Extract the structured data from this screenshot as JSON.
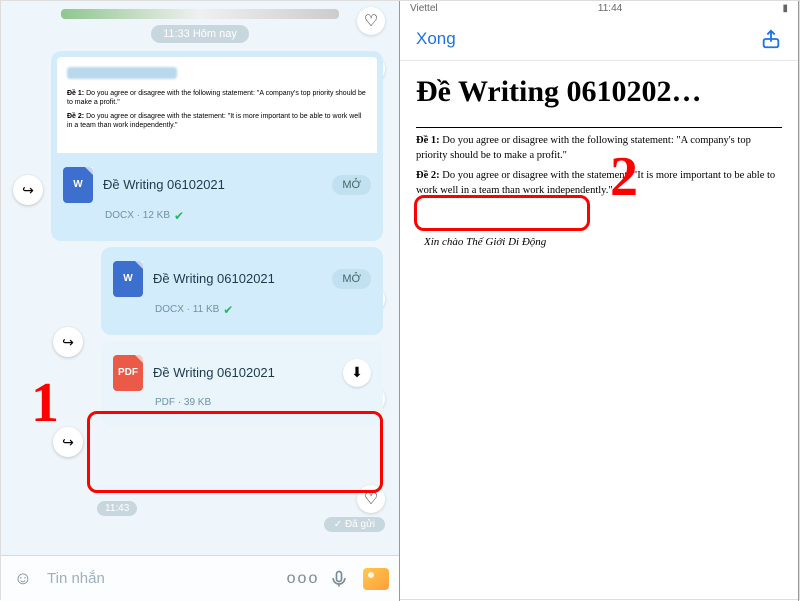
{
  "left": {
    "timestamp_pill": "11:33 Hôm nay",
    "preview": {
      "line1_label": "Đề 1:",
      "line1_text": "Do you agree or disagree with the following statement: \"A company's top priority should be to make a profit.\"",
      "line2_label": "Đề 2:",
      "line2_text": "Do you agree or disagree with the statement: \"It is more important to be able to work well in a team than work independently.\""
    },
    "files": [
      {
        "name": "Đề Writing 06102021",
        "meta": "DOCX · 12 KB",
        "open": "MỞ"
      },
      {
        "name": "Đề Writing 06102021",
        "meta": "DOCX · 11 KB",
        "open": "MỞ"
      },
      {
        "name": "Đề Writing 06102021",
        "meta": "PDF · 39 KB"
      }
    ],
    "time_small": "11:43",
    "sent_label": "✓ Đã gửi",
    "compose_placeholder": "Tin nhắn",
    "annotation_1": "1"
  },
  "right": {
    "carrier": "Viettel",
    "clock": "11:44",
    "done_label": "Xong",
    "title": "Đề Writing 0610202…",
    "body": {
      "line1_label": "Đề 1:",
      "line1_text": "Do you agree or disagree with the following statement: \"A company's top priority should be to make a profit.\"",
      "line2_label": "Đề 2:",
      "line2_text": "Do you agree or disagree with the statement: \"It is more important to be able to work well in a team than work independently.\""
    },
    "signature": "Xin chào Thế Giới Di Động",
    "annotation_2": "2"
  }
}
